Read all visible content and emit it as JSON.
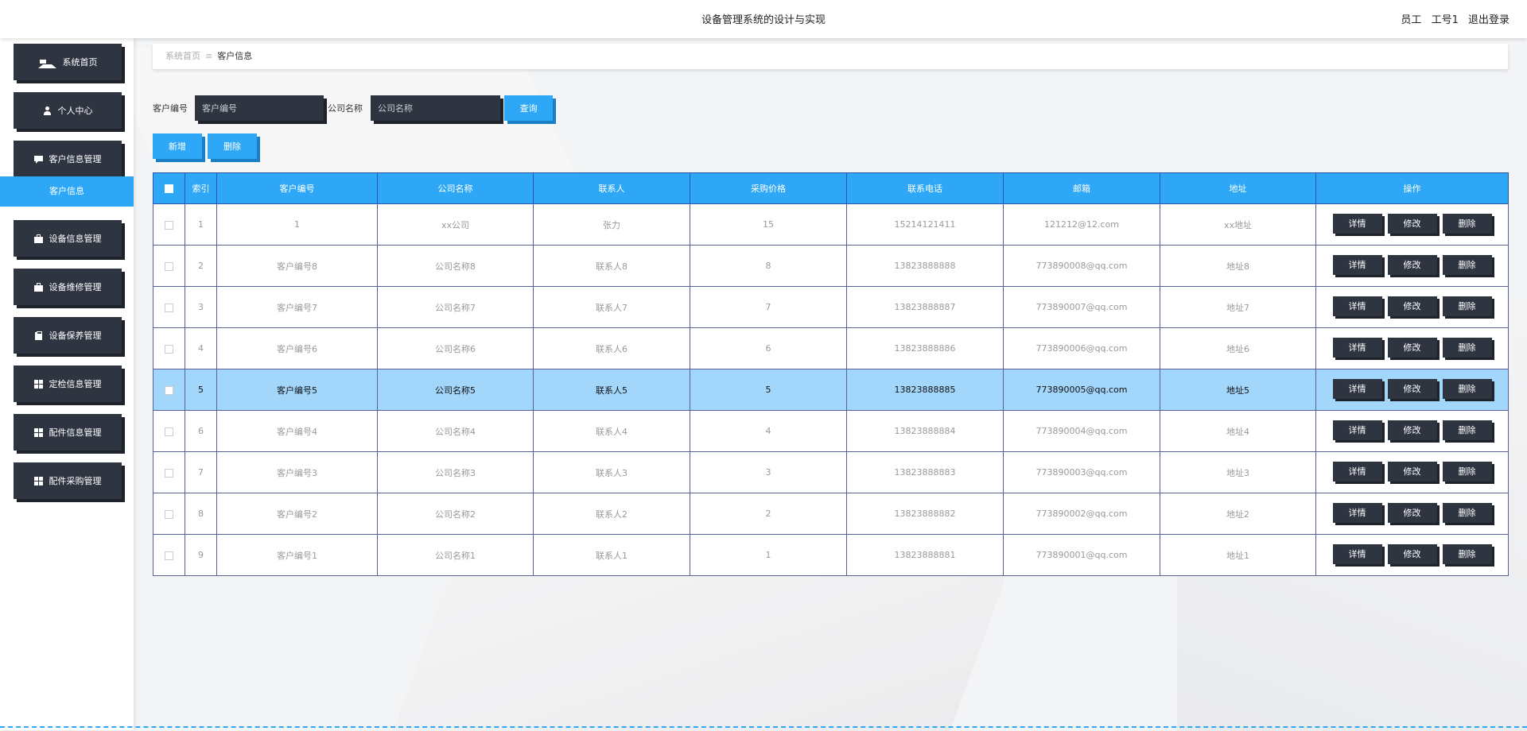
{
  "header": {
    "title": "设备管理系统的设计与实现",
    "user_role": "员工",
    "user_name": "工号1",
    "logout": "退出登录"
  },
  "sidebar": {
    "items": [
      {
        "label": "系统首页",
        "icon": "home-icon"
      },
      {
        "label": "个人中心",
        "icon": "user-icon"
      },
      {
        "label": "客户信息管理",
        "icon": "chat-icon"
      },
      {
        "label": "设备信息管理",
        "icon": "briefcase-icon"
      },
      {
        "label": "设备维修管理",
        "icon": "briefcase-icon"
      },
      {
        "label": "设备保养管理",
        "icon": "clipboard-icon"
      },
      {
        "label": "定检信息管理",
        "icon": "grid-icon"
      },
      {
        "label": "配件信息管理",
        "icon": "grid-icon"
      },
      {
        "label": "配件采购管理",
        "icon": "grid-icon"
      }
    ],
    "active_sub": "客户信息"
  },
  "breadcrumb": {
    "home": "系统首页",
    "separator": "≡",
    "current": "客户信息"
  },
  "search": {
    "customer_no_label": "客户编号",
    "customer_no_placeholder": "客户编号",
    "company_label": "公司名称",
    "company_placeholder": "公司名称",
    "query_button": "查询"
  },
  "actions": {
    "add": "新增",
    "delete": "删除"
  },
  "table": {
    "columns": [
      "索引",
      "客户编号",
      "公司名称",
      "联系人",
      "采购价格",
      "联系电话",
      "邮箱",
      "地址",
      "操作"
    ],
    "row_buttons": {
      "detail": "详情",
      "edit": "修改",
      "delete": "删除"
    },
    "selected_row_index": 4,
    "rows": [
      {
        "index": "1",
        "customer_no": "1",
        "company": "xx公司",
        "contact": "张力",
        "price": "15",
        "phone": "15214121411",
        "email": "121212@12.com",
        "address": "xx地址"
      },
      {
        "index": "2",
        "customer_no": "客户编号8",
        "company": "公司名称8",
        "contact": "联系人8",
        "price": "8",
        "phone": "13823888888",
        "email": "773890008@qq.com",
        "address": "地址8"
      },
      {
        "index": "3",
        "customer_no": "客户编号7",
        "company": "公司名称7",
        "contact": "联系人7",
        "price": "7",
        "phone": "13823888887",
        "email": "773890007@qq.com",
        "address": "地址7"
      },
      {
        "index": "4",
        "customer_no": "客户编号6",
        "company": "公司名称6",
        "contact": "联系人6",
        "price": "6",
        "phone": "13823888886",
        "email": "773890006@qq.com",
        "address": "地址6"
      },
      {
        "index": "5",
        "customer_no": "客户编号5",
        "company": "公司名称5",
        "contact": "联系人5",
        "price": "5",
        "phone": "13823888885",
        "email": "773890005@qq.com",
        "address": "地址5"
      },
      {
        "index": "6",
        "customer_no": "客户编号4",
        "company": "公司名称4",
        "contact": "联系人4",
        "price": "4",
        "phone": "13823888884",
        "email": "773890004@qq.com",
        "address": "地址4"
      },
      {
        "index": "7",
        "customer_no": "客户编号3",
        "company": "公司名称3",
        "contact": "联系人3",
        "price": "3",
        "phone": "13823888883",
        "email": "773890003@qq.com",
        "address": "地址3"
      },
      {
        "index": "8",
        "customer_no": "客户编号2",
        "company": "公司名称2",
        "contact": "联系人2",
        "price": "2",
        "phone": "13823888882",
        "email": "773890002@qq.com",
        "address": "地址2"
      },
      {
        "index": "9",
        "customer_no": "客户编号1",
        "company": "公司名称1",
        "contact": "联系人1",
        "price": "1",
        "phone": "13823888881",
        "email": "773890001@qq.com",
        "address": "地址1"
      }
    ]
  },
  "colors": {
    "accent": "#2ea8f6",
    "dark_button": "#2f3441",
    "selected_row": "#a2d6fb"
  }
}
